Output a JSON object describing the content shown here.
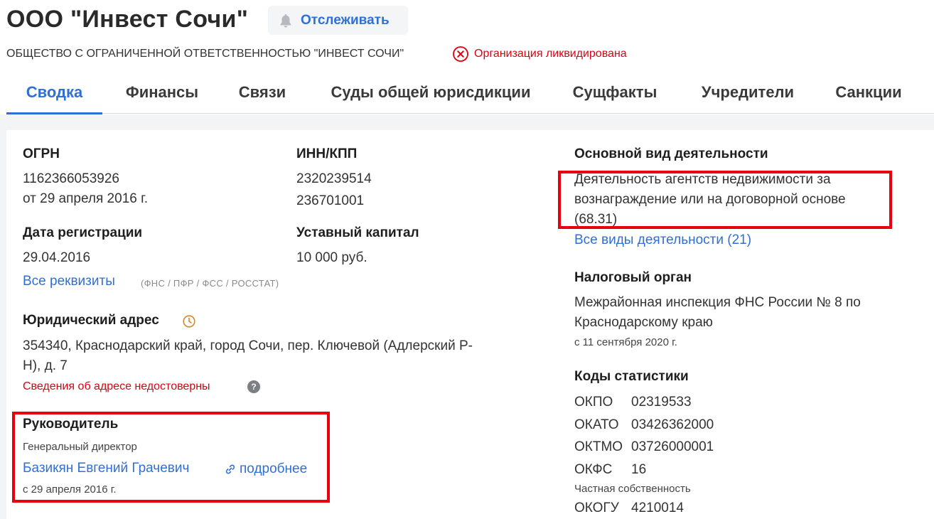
{
  "header": {
    "title": "ООО \"Инвест Сочи\"",
    "follow_label": "Отслеживать",
    "full_name": "ОБЩЕСТВО С ОГРАНИЧЕННОЙ ОТВЕТСТВЕННОСТЬЮ \"ИНВЕСТ СОЧИ\"",
    "status": "Организация ликвидирована"
  },
  "tabs": [
    {
      "label": "Сводка",
      "active": true
    },
    {
      "label": "Финансы"
    },
    {
      "label": "Связи"
    },
    {
      "label": "Суды общей юрисдикции"
    },
    {
      "label": "Сущфакты"
    },
    {
      "label": "Учредители"
    },
    {
      "label": "Санкции"
    }
  ],
  "ogrn": {
    "label": "ОГРН",
    "value": "1162366053926",
    "date": "от 29 апреля 2016 г."
  },
  "inn": {
    "label": "ИНН/КПП",
    "inn": "2320239514",
    "kpp": "236701001"
  },
  "registration": {
    "label": "Дата регистрации",
    "value": "29.04.2016"
  },
  "capital": {
    "label": "Уставный капитал",
    "value": "10 000 руб."
  },
  "requisites": {
    "link": "Все реквизиты",
    "sources": "(ФНС / ПФР / ФСС / РОССТАТ)"
  },
  "address": {
    "label": "Юридический адрес",
    "line1": "354340, Краснодарский край, город Сочи, пер. Ключевой (Адлерский Р-",
    "line2": "Н), д. 7",
    "warning": "Сведения об адресе недостоверны",
    "help": "?"
  },
  "director": {
    "label": "Руководитель",
    "position": "Генеральный директор",
    "name": "Базикян Евгений Грачевич",
    "more_link": "подробнее",
    "since": "с 29 апреля 2016 г."
  },
  "activity": {
    "label": "Основной вид деятельности",
    "line1": "Деятельность агентств недвижимости за",
    "line2": "вознаграждение или на договорной основе",
    "line3": "(68.31)",
    "all_link": "Все виды деятельности (21)"
  },
  "tax": {
    "label": "Налоговый орган",
    "line1": "Межрайонная инспекция ФНС России № 8 по",
    "line2": "Краснодарскому краю",
    "since": "с 11 сентября 2020 г."
  },
  "stats": {
    "label": "Коды статистики",
    "codes": [
      {
        "k": "ОКПО",
        "v": "02319533"
      },
      {
        "k": "ОКАТО",
        "v": "03426362000"
      },
      {
        "k": "ОКТМО",
        "v": "03726000001"
      },
      {
        "k": "ОКФС",
        "v": "16"
      },
      {
        "k": "ОКОГУ",
        "v": "4210014"
      }
    ],
    "okfs_note": "Частная собственность"
  },
  "colors": {
    "accent": "#2f6fd6",
    "danger": "#e0000f",
    "highlight": "#e8000f"
  }
}
